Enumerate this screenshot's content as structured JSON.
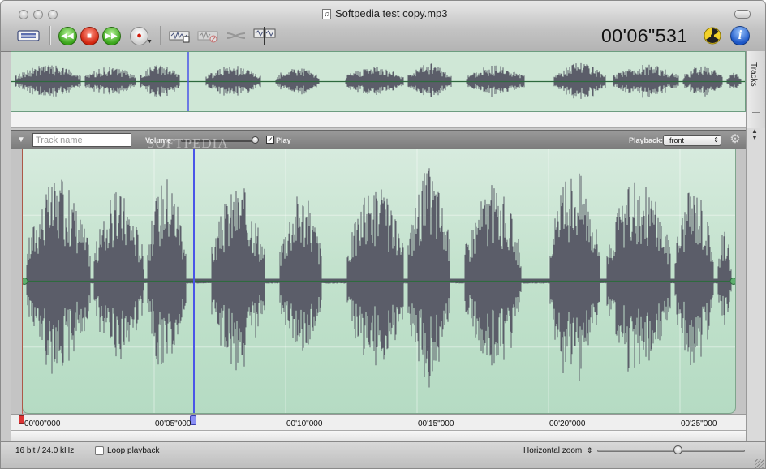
{
  "window": {
    "title": "Softpedia test copy.mp3"
  },
  "toolbar": {
    "time_display": "00'06\"531"
  },
  "colors": {
    "wave_fill": "#5b5d69",
    "wave_bg": "#c3e2cd",
    "playhead": "#4a55e8",
    "zero_line": "#2e6a3e"
  },
  "overview": {
    "tracks_label": "Tracks"
  },
  "track": {
    "name_placeholder": "Track name",
    "volume_label": "Volume",
    "play_label": "Play",
    "playback_label": "Playback:",
    "playback_value": "front"
  },
  "ruler": {
    "ticks": [
      "00'00\"000",
      "00'05\"000",
      "00'10\"000",
      "00'15\"000",
      "00'20\"000",
      "00'25\"000"
    ]
  },
  "status": {
    "format": "16 bit / 24.0 kHz",
    "loop_label": "Loop playback",
    "zoom_label": "Horizontal zoom"
  },
  "watermark": "SOFTPEDIA",
  "icons": {
    "toolbar": [
      "tape-icon",
      "rewind-icon",
      "stop-icon",
      "fast-forward-icon",
      "record-icon",
      "insert-icon",
      "delete-icon",
      "mix-icon",
      "split-icon",
      "radiation-icon",
      "info-icon"
    ]
  }
}
